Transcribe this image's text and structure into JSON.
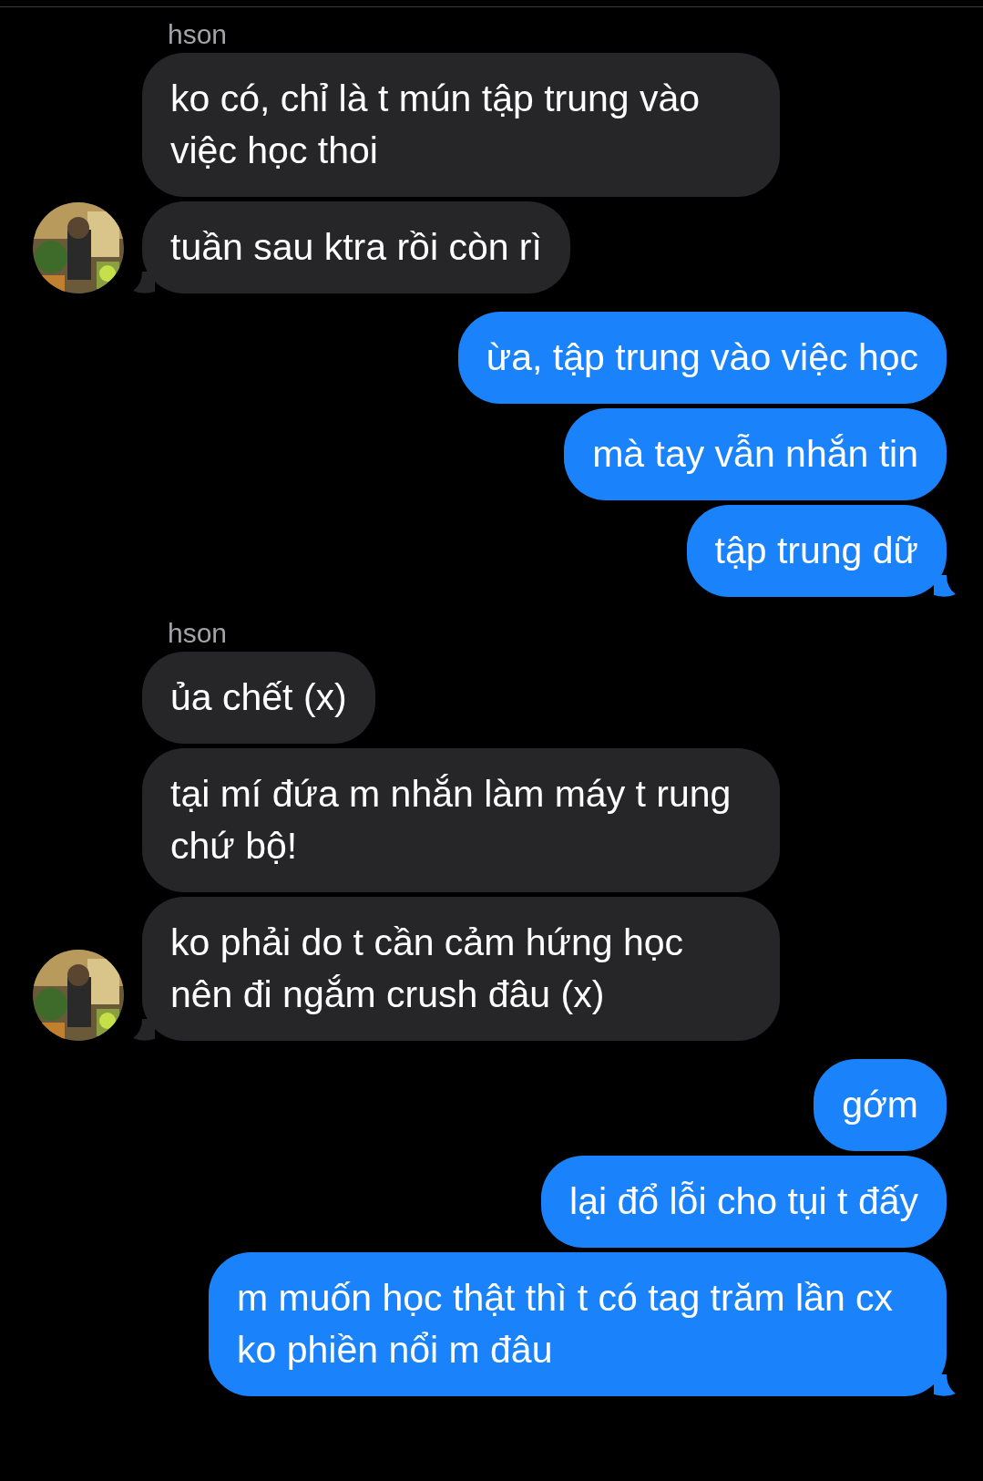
{
  "groups": [
    {
      "kind": "incoming",
      "sender": "hson",
      "messages": [
        "ko có, chỉ là t mún tập trung vào việc học thoi",
        "tuần sau ktra rồi còn rì"
      ]
    },
    {
      "kind": "outgoing",
      "messages": [
        "ừa, tập trung vào việc học",
        "mà tay vẫn nhắn tin",
        "tập trung dữ"
      ]
    },
    {
      "kind": "incoming",
      "sender": "hson",
      "messages": [
        "ủa chết (x)",
        "tại mí đứa m nhắn làm máy t rung chứ bộ!",
        "ko phải do t cần cảm hứng học nên đi ngắm crush đâu (x)"
      ]
    },
    {
      "kind": "outgoing",
      "messages": [
        "gớm",
        "lại đổ lỗi cho tụi t đấy",
        "m muốn học thật thì t có tag trăm lần cx ko phiền nổi m đâu"
      ]
    }
  ]
}
